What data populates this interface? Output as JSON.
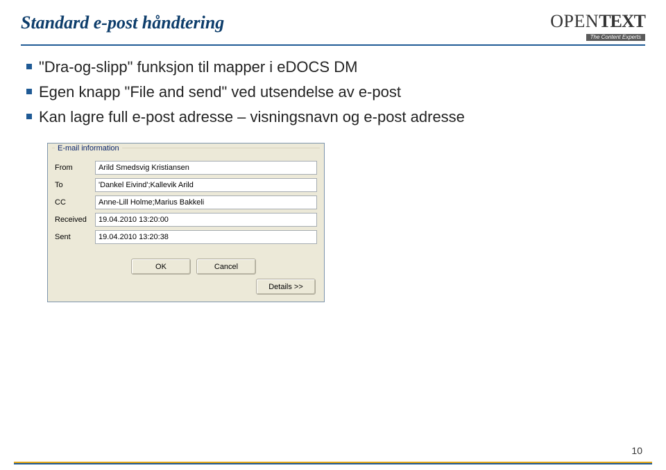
{
  "header": {
    "title": "Standard e-post håndtering",
    "logo_open": "OPEN",
    "logo_text": "TEXT",
    "logo_tag": "The Content Experts"
  },
  "bullets": [
    "\"Dra-og-slipp\" funksjon til mapper i eDOCS DM",
    "Egen knapp \"File and send\" ved utsendelse av e-post",
    "Kan lagre full e-post adresse – visningsnavn og e-post adresse"
  ],
  "dialog": {
    "legend": "E-mail information",
    "rows": {
      "from": {
        "label": "From",
        "value": "Arild Smedsvig Kristiansen"
      },
      "to": {
        "label": "To",
        "value": "'Dankel Eivind';Kallevik Arild"
      },
      "cc": {
        "label": "CC",
        "value": "Anne-Lill Holme;Marius Bakkeli"
      },
      "received": {
        "label": "Received",
        "value": "19.04.2010 13:20:00"
      },
      "sent": {
        "label": "Sent",
        "value": "19.04.2010 13:20:38"
      }
    },
    "buttons": {
      "ok": "OK",
      "cancel": "Cancel",
      "details": "Details >>"
    }
  },
  "page_number": "10"
}
